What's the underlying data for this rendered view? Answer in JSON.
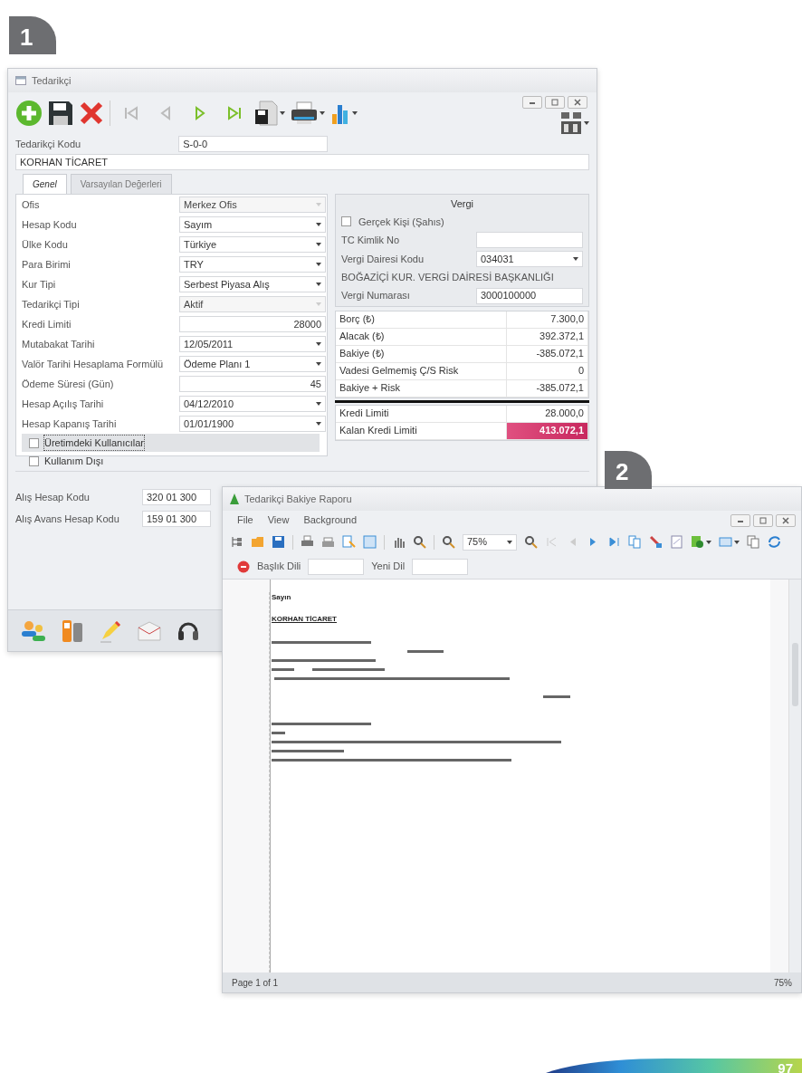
{
  "badges": [
    "1",
    "2"
  ],
  "supplier_window": {
    "title": "Tedarikçi",
    "code_label": "Tedarikçi Kodu",
    "code_value": "S-0-0",
    "name_value": "KORHAN TİCARET",
    "tabs": [
      {
        "label": "Genel",
        "selected": true
      },
      {
        "label": "Varsayılan Değerleri",
        "selected": false
      }
    ],
    "fields": [
      {
        "label": "Ofis",
        "value": "Merkez Ofis",
        "kind": "locked"
      },
      {
        "label": "Hesap Kodu",
        "value": "Sayım",
        "kind": "combo"
      },
      {
        "label": "Ülke Kodu",
        "value": "Türkiye",
        "kind": "combo"
      },
      {
        "label": "Para Birimi",
        "value": "TRY",
        "kind": "combo"
      },
      {
        "label": "Kur Tipi",
        "value": "Serbest Piyasa Alış",
        "kind": "combo"
      },
      {
        "label": "Tedarikçi Tipi",
        "value": "Aktif",
        "kind": "locked"
      },
      {
        "label": "Kredi Limiti",
        "value": "28000",
        "kind": "number"
      },
      {
        "label": "Mutabakat Tarihi",
        "value": "12/05/2011",
        "kind": "combo"
      },
      {
        "label": "Valör Tarihi Hesaplama Formülü",
        "value": "Ödeme Planı 1",
        "kind": "combo"
      },
      {
        "label": "Ödeme Süresi (Gün)",
        "value": "45",
        "kind": "number"
      },
      {
        "label": "Hesap Açılış Tarihi",
        "value": "04/12/2010",
        "kind": "combo"
      },
      {
        "label": "Hesap Kapanış Tarihi",
        "value": "01/01/1900",
        "kind": "combo"
      }
    ],
    "checks": [
      {
        "label": "Üretimdeki Kullanıcılar",
        "checked": false,
        "focused": true
      },
      {
        "label": "Kullanım Dışı",
        "checked": false,
        "focused": false
      }
    ],
    "tax": {
      "title": "Vergi",
      "person_check": {
        "label": "Gerçek Kişi (Şahıs)",
        "checked": false
      },
      "id_label": "TC Kimlik No",
      "office_label": "Vergi Dairesi Kodu",
      "office_value": "034031",
      "office_name": "BOĞAZİÇİ KUR. VERGİ DAİRESİ BAŞKANLIĞI",
      "number_label": "Vergi Numarası",
      "number_value": "3000100000"
    },
    "balances": [
      {
        "label": "Borç (₺)",
        "value": "7.300,0"
      },
      {
        "label": "Alacak (₺)",
        "value": "392.372,1"
      },
      {
        "label": "Bakiye (₺)",
        "value": "-385.072,1"
      },
      {
        "label": "Vadesi Gelmemiş Ç/S Risk",
        "value": "0"
      },
      {
        "label": "Bakiye + Risk",
        "value": "-385.072,1"
      }
    ],
    "credit": [
      {
        "label": "Kredi Limiti",
        "value": "28.000,0",
        "alert": false
      },
      {
        "label": "Kalan Kredi Limiti",
        "value": "413.072,1",
        "alert": true
      }
    ],
    "accounts": [
      {
        "label": "Alış Hesap Kodu",
        "value": "320 01 300"
      },
      {
        "label": "Alış Avans Hesap Kodu",
        "value": "159 01 300"
      }
    ]
  },
  "report_window": {
    "title": "Tedarikçi Bakiye Raporu",
    "menu": [
      "File",
      "View",
      "Background"
    ],
    "zoom": "75%",
    "params": [
      {
        "label": "Başlık Dili"
      },
      {
        "label": "Yeni Dil"
      }
    ],
    "doc_lines": [
      {
        "text": "Sayın",
        "kind": "bold"
      },
      {
        "text": "KORHAN TİCARET",
        "kind": "heading"
      }
    ],
    "status": {
      "page": "Page 1 of 1",
      "zoom": "75%"
    }
  },
  "page_number": "97"
}
